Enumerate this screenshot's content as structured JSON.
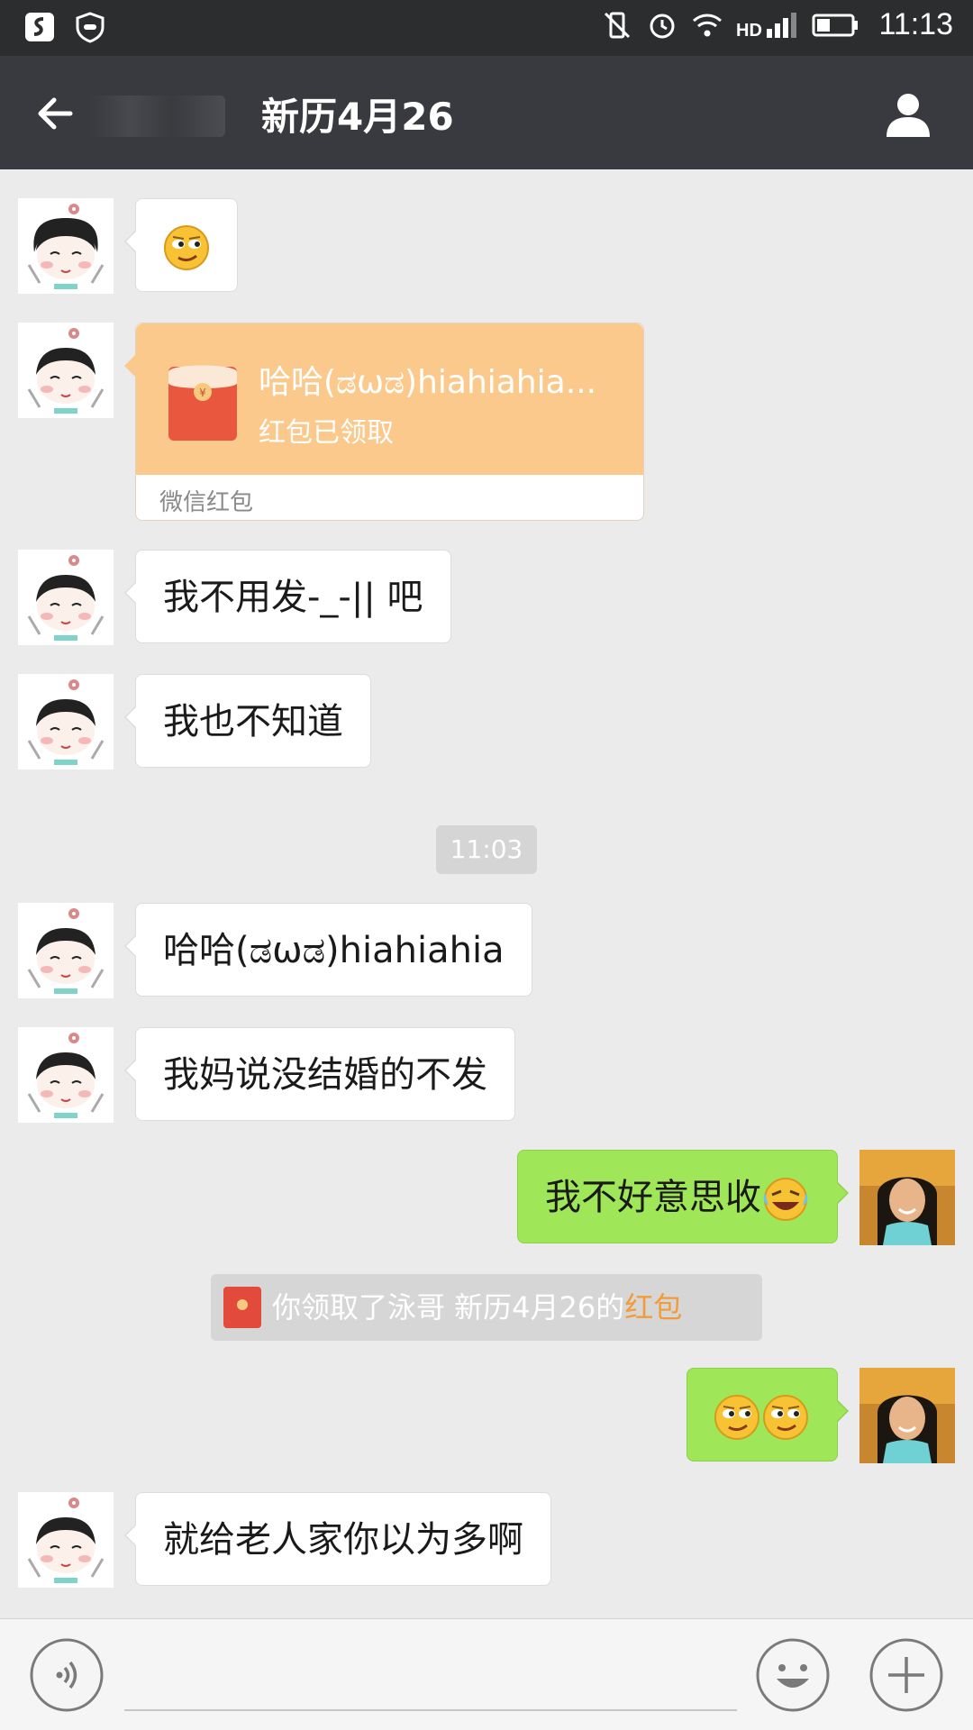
{
  "status_bar": {
    "time": "11:13",
    "icons": [
      "soul-app-icon",
      "shield-icon",
      "vibrate-off-icon",
      "alarm-icon",
      "wifi-icon",
      "hd-signal-icon",
      "battery-icon"
    ]
  },
  "nav": {
    "title": "新历4月26",
    "back_icon": "back-arrow-icon",
    "profile_icon": "person-icon"
  },
  "messages": [
    {
      "side": "left",
      "type": "emoji",
      "emoji": "smirk-emoji"
    },
    {
      "side": "left",
      "type": "red_packet",
      "title": "哈哈(ಡωಡ)hiahiahia...",
      "status": "红包已领取",
      "footer": "微信红包"
    },
    {
      "side": "left",
      "type": "text",
      "text": "我不用发-_-|| 吧"
    },
    {
      "side": "left",
      "type": "text",
      "text": "我也不知道"
    },
    {
      "type": "time",
      "text": "11:03"
    },
    {
      "side": "left",
      "type": "text",
      "text": "哈哈(ಡωಡ)hiahiahia"
    },
    {
      "side": "left",
      "type": "text",
      "text": "我妈说没结婚的不发"
    },
    {
      "side": "right",
      "type": "text",
      "text": "我不好意思收",
      "emoji": "laugh-cry-emoji"
    },
    {
      "type": "system",
      "text": "你领取了泳哥  新历4月26的",
      "link": "红包"
    },
    {
      "side": "right",
      "type": "emoji",
      "emoji": "smirk-emoji x2"
    },
    {
      "side": "left",
      "type": "text",
      "text": "就给老人家你以为多啊"
    }
  ],
  "input_bar": {
    "voice_icon": "voice-icon",
    "emoji_icon": "smiley-icon",
    "plus_icon": "plus-icon"
  },
  "colors": {
    "status_bar": "#2c2d2f",
    "nav_bar": "#393a3f",
    "chat_bg": "#ebebeb",
    "sent_bubble": "#9fe658",
    "red_packet": "#fbc98b",
    "link": "#f29b38"
  }
}
